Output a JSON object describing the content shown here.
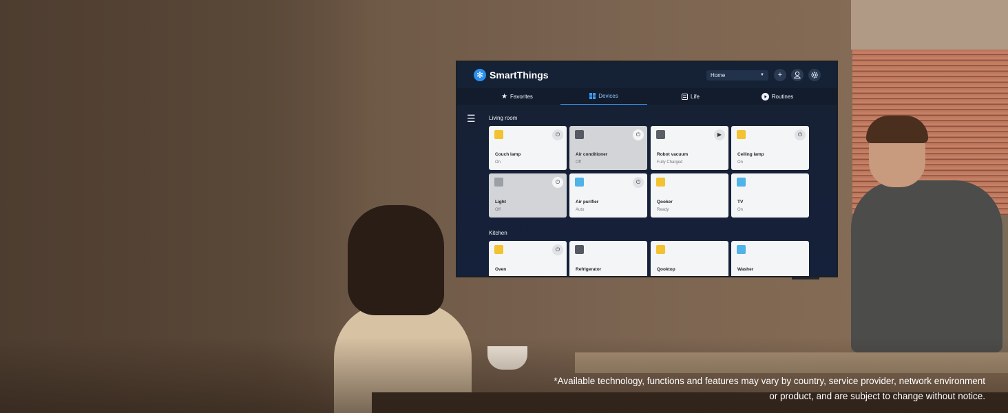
{
  "app": {
    "brand": "SmartThings",
    "brand_icon": "snowflake-logo"
  },
  "header": {
    "location_select": "Home",
    "add_icon": "plus-icon",
    "profile_icon": "user-icon",
    "settings_icon": "gear-icon"
  },
  "tabs": [
    {
      "label": "Favorites",
      "icon": "star-icon",
      "active": false
    },
    {
      "label": "Devices",
      "icon": "grid-icon",
      "active": true
    },
    {
      "label": "Life",
      "icon": "life-icon",
      "active": false
    },
    {
      "label": "Routines",
      "icon": "play-circle-icon",
      "active": false
    }
  ],
  "rooms": [
    {
      "title": "Living room",
      "devices": [
        {
          "name": "Couch lamp",
          "status": "On",
          "control": "power",
          "on": true,
          "icon_color": "#f2c230"
        },
        {
          "name": "Air conditioner",
          "status": "Off",
          "control": "power",
          "on": false,
          "icon_color": "#555a62"
        },
        {
          "name": "Robot vacuum",
          "status": "Fully Charged",
          "control": "play",
          "on": true,
          "icon_color": "#5b5f66"
        },
        {
          "name": "Ceiling lamp",
          "status": "On",
          "control": "power",
          "on": true,
          "icon_color": "#f2c230"
        },
        {
          "name": "Light",
          "status": "Off",
          "control": "power",
          "on": false,
          "icon_color": "#9ca0a6"
        },
        {
          "name": "Air purifier",
          "status": "Auto",
          "control": "power",
          "on": true,
          "icon_color": "#4fb3e8"
        },
        {
          "name": "Qooker",
          "status": "Ready",
          "control": "none",
          "on": true,
          "icon_color": "#f2c230"
        },
        {
          "name": "TV",
          "status": "On",
          "control": "none",
          "on": true,
          "icon_color": "#4fb3e8"
        }
      ]
    },
    {
      "title": "Kitchen",
      "devices": [
        {
          "name": "Oven",
          "status": "",
          "control": "power",
          "on": true,
          "icon_color": "#f2c230"
        },
        {
          "name": "Refrigerator",
          "status": "",
          "control": "none",
          "on": true,
          "icon_color": "#555a62"
        },
        {
          "name": "Qooktop",
          "status": "",
          "control": "none",
          "on": true,
          "icon_color": "#f2c230"
        },
        {
          "name": "Washer",
          "status": "",
          "control": "none",
          "on": true,
          "icon_color": "#4fb3e8"
        }
      ]
    }
  ],
  "disclaimer": "*Available technology, functions and features may vary by country, service provider, network environment or product, and are subject to change without notice."
}
